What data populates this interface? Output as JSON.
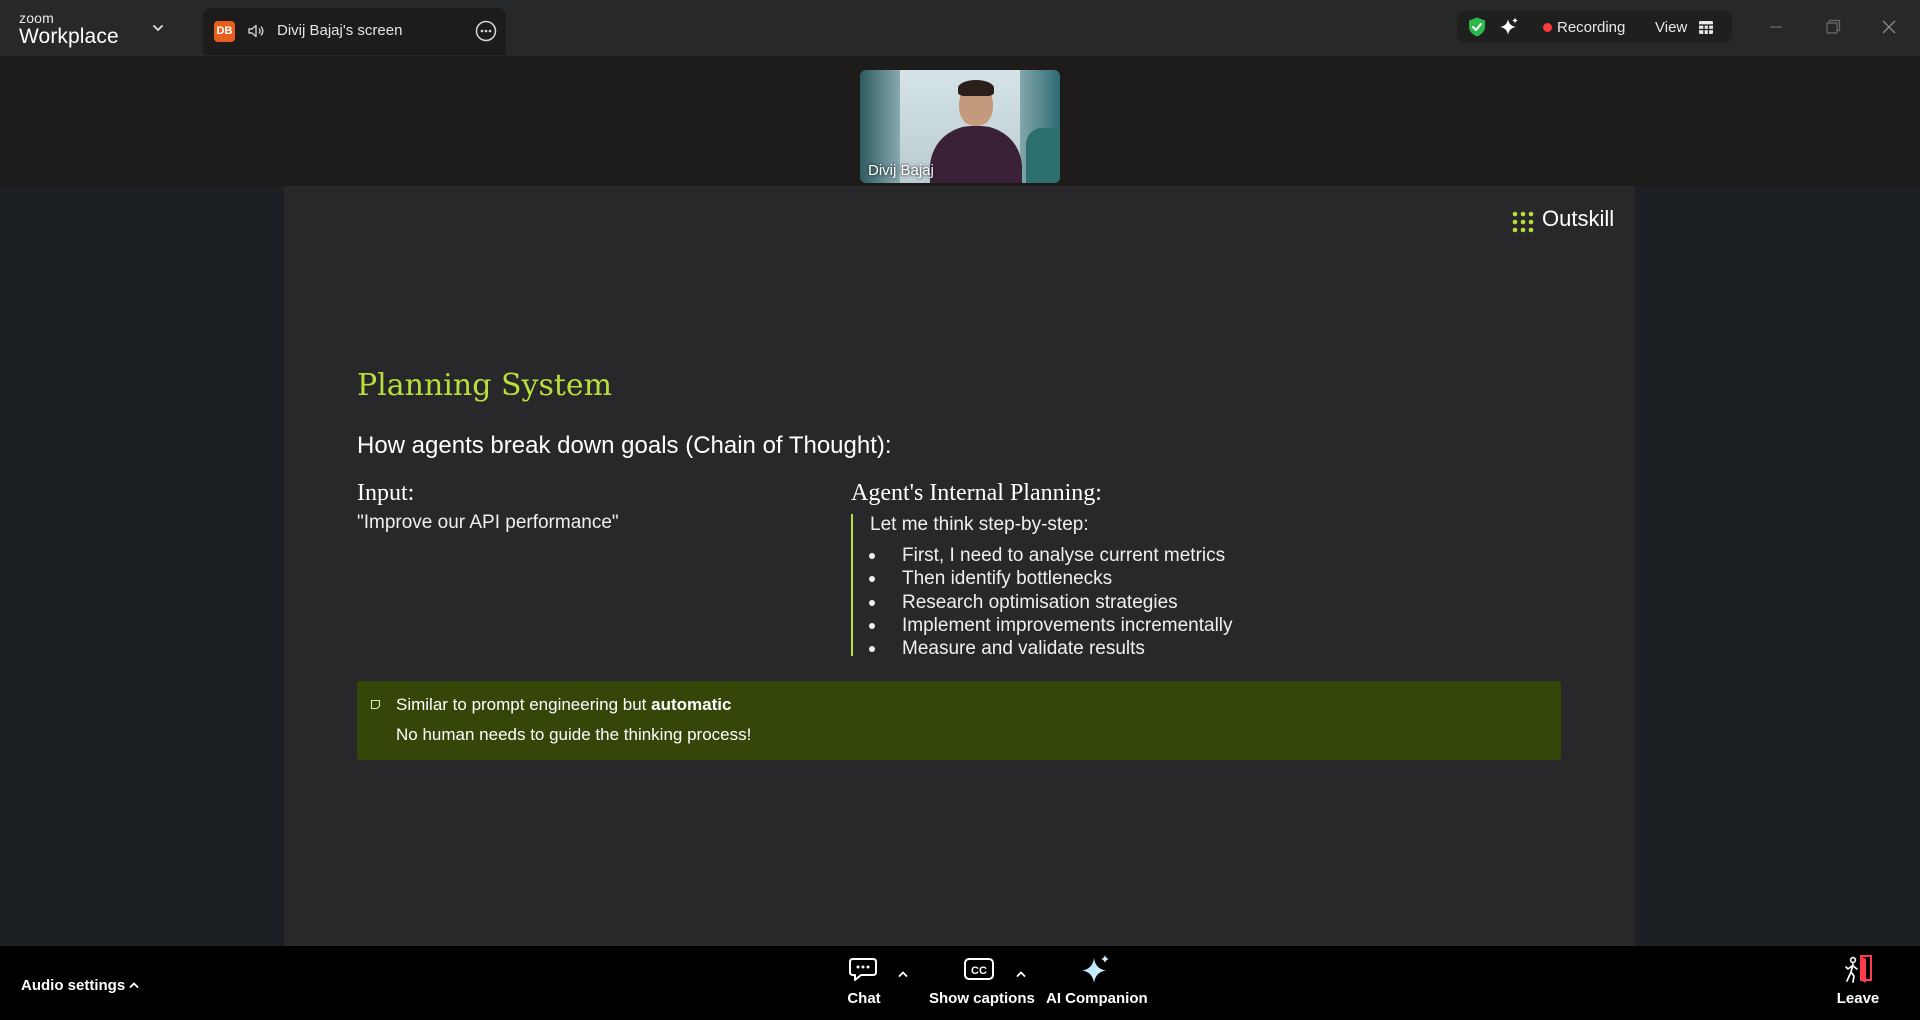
{
  "app": {
    "brand_small": "zoom",
    "brand_big": "Workplace"
  },
  "tab": {
    "avatar_initials": "DB",
    "title": "Divij Bajaj's screen"
  },
  "status": {
    "recording_label": "Recording",
    "view_label": "View",
    "recording_color": "#ff3b3b",
    "shield_color": "#2db84b"
  },
  "video": {
    "participant_name": "Divij Bajaj"
  },
  "slide": {
    "brand": "Outskill",
    "title": "Planning System",
    "subtitle": "How agents break down goals (Chain of Thought):",
    "input_heading": "Input:",
    "input_text": "\"Improve our API performance\"",
    "planning_heading": "Agent's Internal Planning:",
    "planning_lead": "Let me think step-by-step:",
    "steps": [
      "First, I need to analyse current metrics",
      "Then identify bottlenecks",
      "Research optimisation strategies",
      "Implement improvements incrementally",
      "Measure and validate results"
    ],
    "callout_prefix": "Similar to prompt engineering but ",
    "callout_bold": "automatic",
    "callout_line2": "No human needs to guide the thinking process!",
    "accent_color": "#b8e03c",
    "callout_bg": "#344709"
  },
  "bottom": {
    "audio_settings": "Audio settings",
    "chat": "Chat",
    "captions": "Show captions",
    "ai_companion": "AI Companion",
    "leave": "Leave"
  }
}
